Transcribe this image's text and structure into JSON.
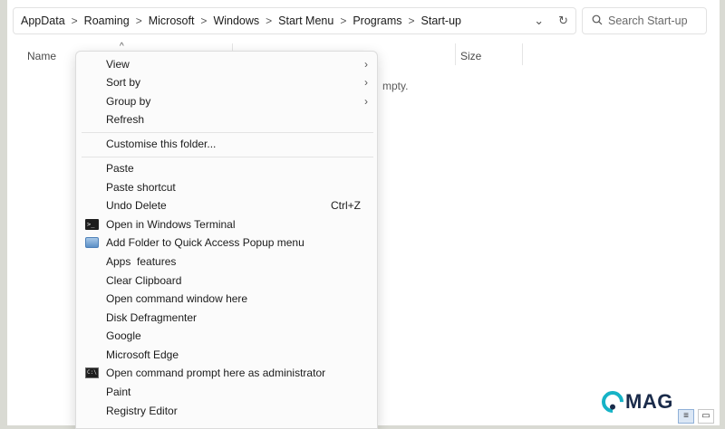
{
  "address": {
    "breadcrumbs": [
      "AppData",
      "Roaming",
      "Microsoft",
      "Windows",
      "Start Menu",
      "Programs",
      "Start-up"
    ],
    "separator": ">",
    "dropdown_glyph": "⌄",
    "refresh_glyph": "↻"
  },
  "search": {
    "placeholder": "Search Start-up",
    "icon": "search-icon"
  },
  "columns": {
    "name": "Name",
    "size": "Size"
  },
  "empty_text": "mpty.",
  "context_menu": {
    "group1": [
      {
        "label": "View",
        "submenu": true
      },
      {
        "label": "Sort by",
        "submenu": true
      },
      {
        "label": "Group by",
        "submenu": true
      },
      {
        "label": "Refresh",
        "submenu": false
      }
    ],
    "group2": [
      {
        "label": "Customise this folder..."
      }
    ],
    "group3": [
      {
        "label": "Paste"
      },
      {
        "label": "Paste shortcut"
      },
      {
        "label": "Undo Delete",
        "shortcut": "Ctrl+Z"
      },
      {
        "label": "Open in Windows Terminal",
        "icon": "terminal-icon"
      },
      {
        "label": "Add Folder to Quick Access Popup menu",
        "icon": "folder-icon"
      },
      {
        "label": "Apps  features"
      },
      {
        "label": "Clear Clipboard"
      },
      {
        "label": "Open command window here"
      },
      {
        "label": "Disk Defragmenter"
      },
      {
        "label": "Google"
      },
      {
        "label": "Microsoft Edge"
      },
      {
        "label": "Open command prompt here as administrator",
        "icon": "cmd-icon"
      },
      {
        "label": "Paint"
      },
      {
        "label": "Registry Editor"
      }
    ]
  },
  "watermark": {
    "text": "MAG"
  },
  "colors": {
    "accent": "#16b3c6",
    "logo_dark": "#1a2b4a"
  }
}
